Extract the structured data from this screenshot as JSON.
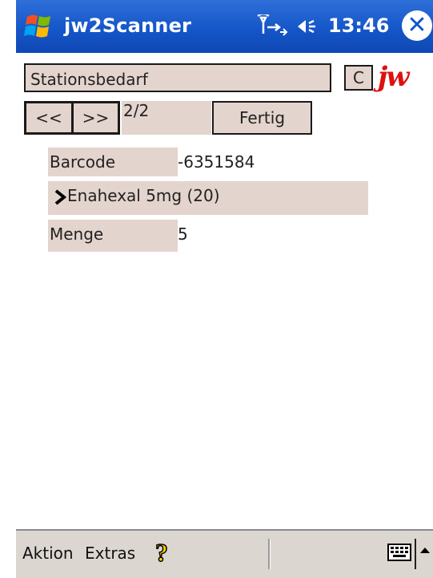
{
  "titlebar": {
    "app_title": "jw2Scanner",
    "time": "13:46"
  },
  "form": {
    "location_value": "Stationsbedarf",
    "clear_label": "C",
    "logo_text": "jw",
    "prev_label": "<<",
    "next_label": ">>",
    "page_indicator": "2/2",
    "done_label": "Fertig",
    "barcode_label": "Barcode",
    "barcode_value": "-6351584",
    "product_name": "Enahexal 5mg (20)",
    "quantity_label": "Menge",
    "quantity_value": "5"
  },
  "menubar": {
    "action_label": "Aktion",
    "extras_label": "Extras"
  },
  "icons": {
    "start": "windows-flag-icon",
    "connectivity": "signal-icon",
    "volume": "speaker-icon",
    "close": "close-icon",
    "help": "help-icon",
    "keyboard": "keyboard-icon",
    "sip_arrow": "chevron-up-icon",
    "product_marker": "chevron-right-icon"
  },
  "colors": {
    "titlebar_blue": "#1556c9",
    "field_background": "#e3d4cd",
    "logo_red": "#dd1111",
    "menubar_background": "#dcd6d1"
  }
}
